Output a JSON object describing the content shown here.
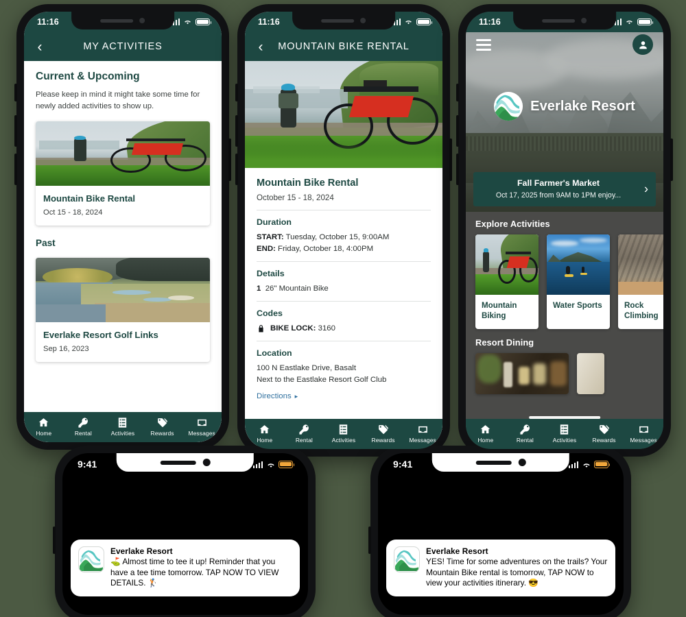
{
  "theme": {
    "brand_green": "#1d4842",
    "page_bg": "#4c5a43",
    "link_blue": "#2e6f9e",
    "logo_teal": "#57c6c2",
    "logo_green": "#3aa85a"
  },
  "phone1": {
    "status": {
      "time": "11:16",
      "wifi_icon": "wifi-icon",
      "signal_icon": "signal-bars-icon",
      "battery_icon": "battery-full-icon"
    },
    "appbar": {
      "back_icon": "chevron-left-icon",
      "title": "MY ACTIVITIES"
    },
    "section_heading": "Current & Upcoming",
    "section_note": "Please keep in mind it might take some time for newly added activities to show up.",
    "upcoming": [
      {
        "name": "Mountain Bike Rental",
        "date": "Oct 15 - 18, 2024",
        "image": "mountain-bike-lake-photo"
      }
    ],
    "past_heading": "Past",
    "past": [
      {
        "name": "Everlake Resort Golf Links",
        "date": "Sep 16, 2023",
        "image": "golf-course-lake-photo"
      }
    ]
  },
  "phone2": {
    "status": {
      "time": "11:16"
    },
    "appbar": {
      "back_icon": "chevron-left-icon",
      "title": "MOUNTAIN BIKE RENTAL"
    },
    "hero_image": "mountain-bike-lake-photo",
    "title": "Mountain Bike Rental",
    "subtitle": "October 15 - 18, 2024",
    "sections": [
      {
        "label": "Duration",
        "lines": [
          {
            "key": "START:",
            "value": "Tuesday, October 15, 9:00AM"
          },
          {
            "key": "END:",
            "value": "Friday, October 18, 4:00PM"
          }
        ]
      },
      {
        "label": "Details",
        "lines": [
          {
            "key": "1",
            "value": "26\" Mountain Bike"
          }
        ]
      },
      {
        "label": "Codes",
        "lock_icon": "lock-icon",
        "lines": [
          {
            "key": "BIKE LOCK:",
            "value": "3160"
          }
        ]
      },
      {
        "label": "Location",
        "lines": [
          {
            "key": "",
            "value": "100 N Eastlake Drive, Basalt"
          },
          {
            "key": "",
            "value": "Next to the Eastlake Resort Golf Club"
          }
        ],
        "link": "Directions",
        "link_icon": "caret-right-icon"
      }
    ]
  },
  "phone3": {
    "status": {
      "time": "11:16"
    },
    "menu_icon": "hamburger-menu-icon",
    "account_icon": "user-avatar-icon",
    "brand_name": "Everlake Resort",
    "brand_logo_icon": "everlake-mountain-logo-icon",
    "hero_image": "mountain-range-forest-photo",
    "promo": {
      "title": "Fall Farmer's Market",
      "subtitle": "Oct 17, 2025 from 9AM to 1PM enjoy...",
      "chevron_icon": "chevron-right-icon"
    },
    "explore_heading": "Explore Activities",
    "explore_cards": [
      {
        "name": "Mountain Biking",
        "image": "mountain-bike-lake-photo"
      },
      {
        "name": "Water Sports",
        "image": "paddleboard-lake-photo"
      },
      {
        "name": "Rock Climbing",
        "image": "rock-wall-photo"
      }
    ],
    "dining_heading": "Resort Dining",
    "dining_cards": [
      {
        "image": "restaurant-bar-photo"
      },
      {
        "image": "dining-table-photo"
      }
    ]
  },
  "tabbar": {
    "items": [
      {
        "label": "Home",
        "icon": "home-icon",
        "active": true
      },
      {
        "label": "Rental",
        "icon": "key-icon",
        "active": false
      },
      {
        "label": "Activities",
        "icon": "list-clipboard-icon",
        "active": false
      },
      {
        "label": "Rewards",
        "icon": "tags-icon",
        "active": false
      },
      {
        "label": "Messages",
        "icon": "inbox-icon",
        "active": false
      }
    ]
  },
  "phone4": {
    "status": {
      "time": "9:41",
      "battery_icon": "battery-amber-icon"
    },
    "notification": {
      "app_icon": "everlake-mountain-logo-icon",
      "app_name": "Everlake Resort",
      "message": "⛳  Almost time to tee it up! Reminder that you have a tee time tomorrow. TAP NOW TO VIEW DETAILS. 🏌️"
    }
  },
  "phone5": {
    "status": {
      "time": "9:41",
      "battery_icon": "battery-amber-icon"
    },
    "notification": {
      "app_icon": "everlake-mountain-logo-icon",
      "app_name": "Everlake Resort",
      "message": "YES! Time for some adventures on the trails? Your Mountain Bike rental is tomorrow, TAP NOW to view your activities itinerary. 😎"
    }
  }
}
